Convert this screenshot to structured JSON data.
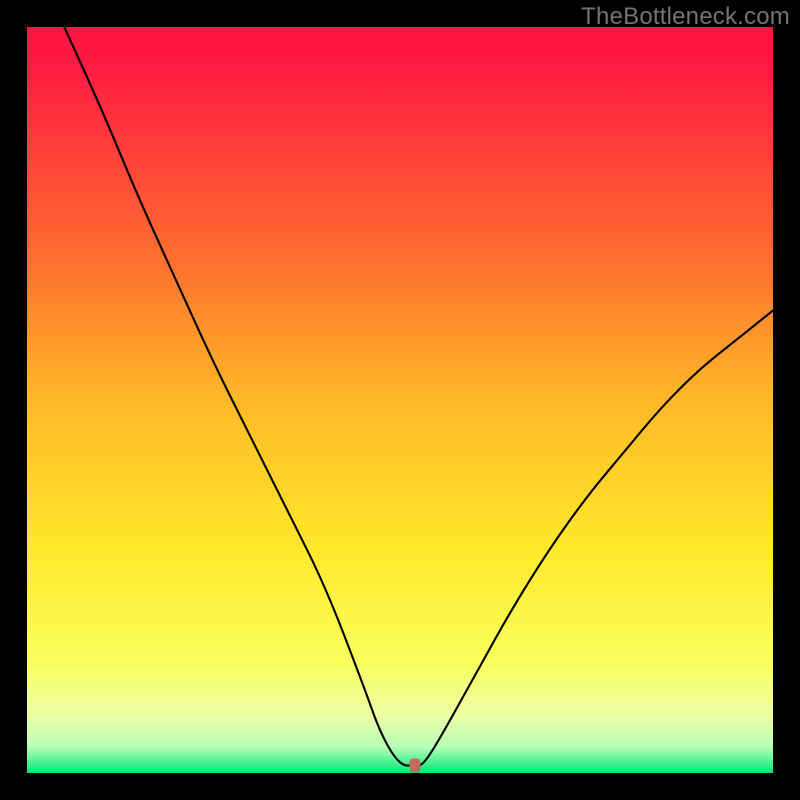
{
  "watermark": "TheBottleneck.com",
  "chart_data": {
    "type": "line",
    "title": "",
    "xlabel": "",
    "ylabel": "",
    "xlim": [
      0,
      100
    ],
    "ylim": [
      0,
      100
    ],
    "series": [
      {
        "name": "curve",
        "x": [
          5.0,
          10.0,
          15.0,
          20.0,
          25.0,
          30.0,
          35.0,
          40.0,
          45.0,
          47.5,
          50.0,
          52.0,
          53.0,
          55.0,
          60.0,
          65.0,
          70.0,
          75.0,
          80.0,
          85.0,
          90.0,
          95.0,
          100.0
        ],
        "y": [
          100.0,
          89.0,
          77.0,
          66.0,
          55.0,
          45.0,
          35.0,
          25.0,
          12.0,
          5.0,
          1.0,
          1.0,
          1.0,
          4.0,
          13.0,
          22.0,
          30.0,
          37.0,
          43.0,
          49.0,
          54.0,
          58.0,
          62.0
        ]
      }
    ],
    "marker": {
      "x": 52.0,
      "y": 1.0,
      "color": "#c46a5f"
    },
    "gradient_stops": [
      {
        "pos": 0.0,
        "color": "#ff1442"
      },
      {
        "pos": 0.05,
        "color": "#ff1a42"
      },
      {
        "pos": 0.3,
        "color": "#ff6a30"
      },
      {
        "pos": 0.5,
        "color": "#ffb828"
      },
      {
        "pos": 0.7,
        "color": "#ffe82a"
      },
      {
        "pos": 0.85,
        "color": "#f9ff5c"
      },
      {
        "pos": 0.92,
        "color": "#eeffa0"
      },
      {
        "pos": 0.965,
        "color": "#b8ffb8"
      },
      {
        "pos": 1.0,
        "color": "#00e878"
      }
    ]
  }
}
